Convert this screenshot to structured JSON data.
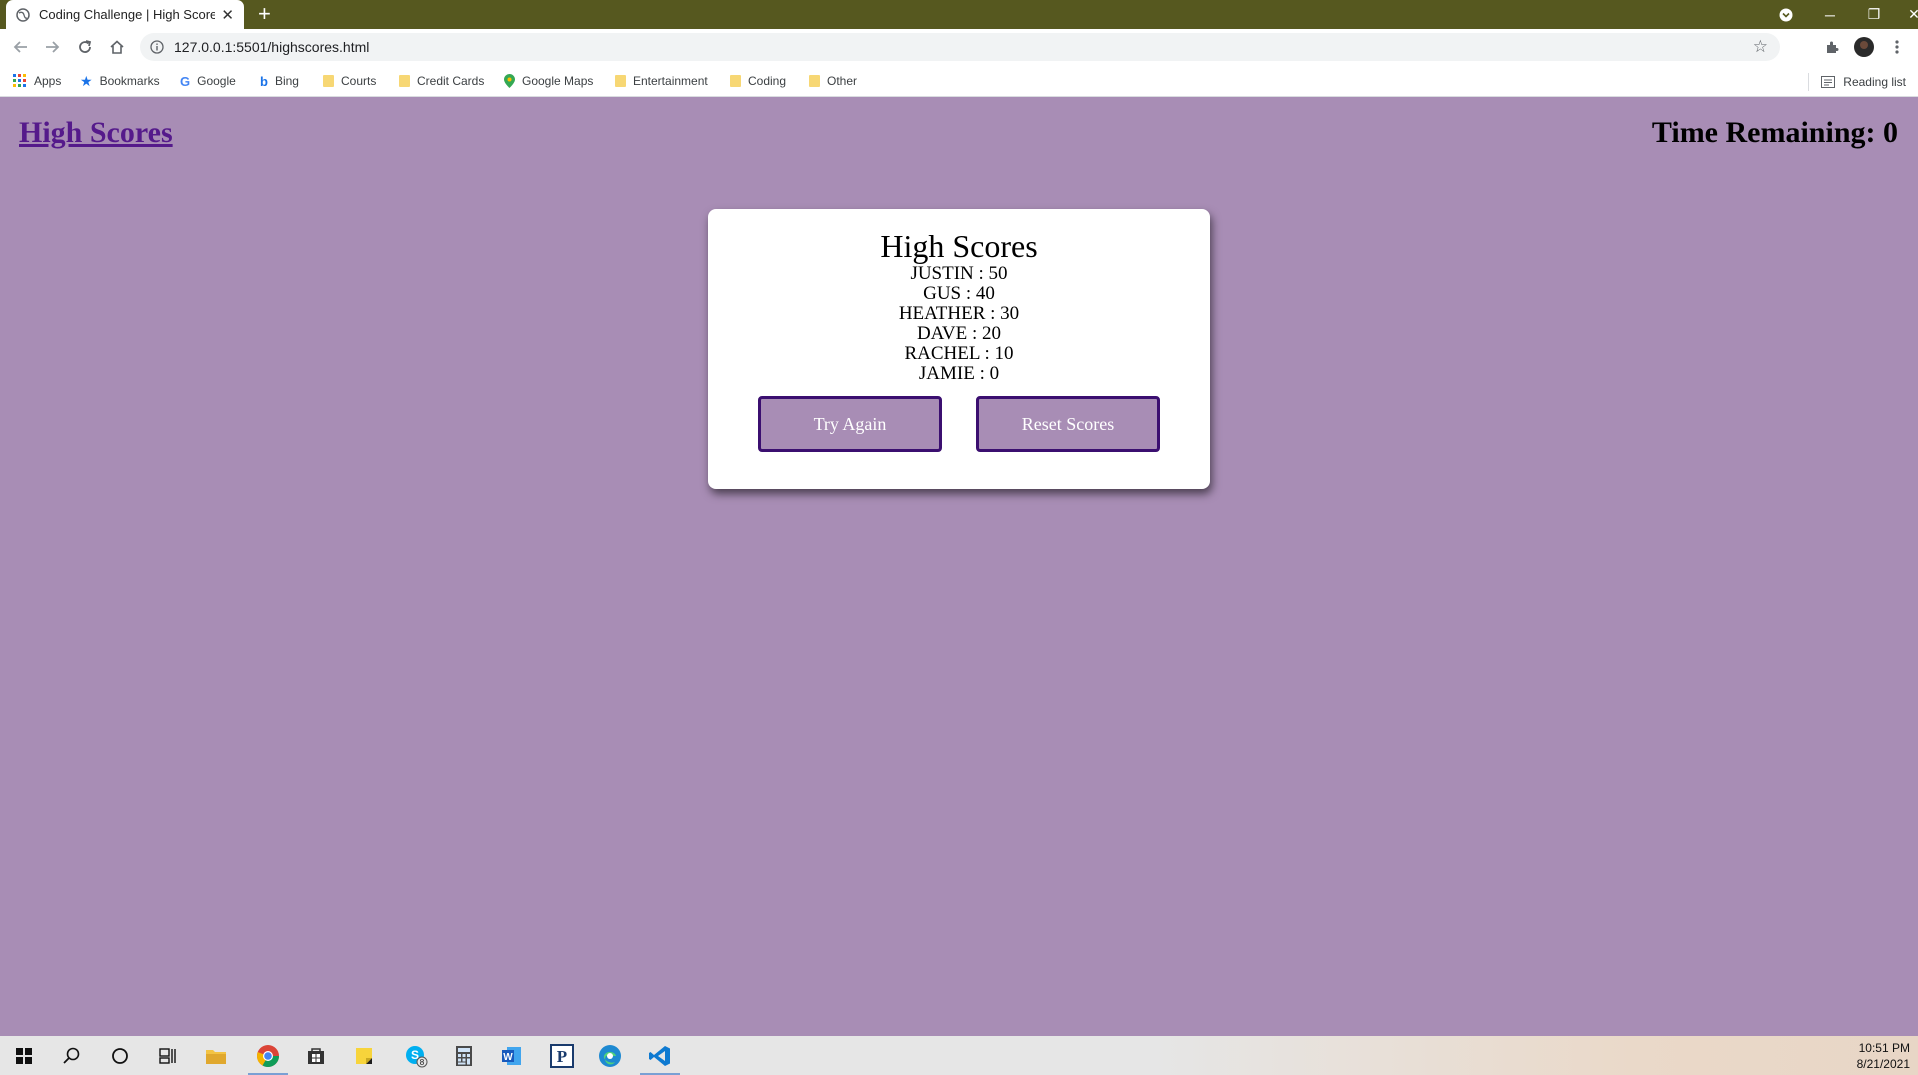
{
  "browser": {
    "tab_title": "Coding Challenge | High Scores",
    "url": "127.0.0.1:5501/highscores.html",
    "bookmarks": [
      {
        "label": "Apps",
        "icon": "apps-grid-icon"
      },
      {
        "label": "Bookmarks",
        "icon": "star-icon"
      },
      {
        "label": "Google",
        "icon": "google-icon"
      },
      {
        "label": "Bing",
        "icon": "bing-icon"
      },
      {
        "label": "Courts",
        "icon": "folder-icon"
      },
      {
        "label": "Credit Cards",
        "icon": "folder-icon"
      },
      {
        "label": "Google Maps",
        "icon": "maps-pin-icon"
      },
      {
        "label": "Entertainment",
        "icon": "folder-icon"
      },
      {
        "label": "Coding",
        "icon": "folder-icon"
      },
      {
        "label": "Other",
        "icon": "folder-icon"
      }
    ],
    "reading_list": "Reading list",
    "colors": {
      "titlebar": "#56581f",
      "page_bg": "#a88db5",
      "button_border": "#3b0f70"
    }
  },
  "page": {
    "header_link": "High Scores",
    "timer": "Time Remaining: 0",
    "card": {
      "title": "High Scores",
      "scores": [
        "JUSTIN : 50",
        "GUS : 40",
        "HEATHER : 30",
        "DAVE : 20",
        "RACHEL : 10",
        "JAMIE : 0"
      ],
      "try_again": "Try Again",
      "reset_scores": "Reset Scores"
    }
  },
  "taskbar": {
    "items": [
      "start-icon",
      "search-icon",
      "cortana-icon",
      "task-view-icon",
      "file-explorer-icon",
      "chrome-icon",
      "store-icon",
      "sticky-notes-icon",
      "skype-icon",
      "calculator-icon",
      "word-icon",
      "publisher-icon",
      "edge-icon",
      "vscode-icon"
    ],
    "skype_badge": "8",
    "time": "10:51 PM",
    "date": "8/21/2021"
  }
}
